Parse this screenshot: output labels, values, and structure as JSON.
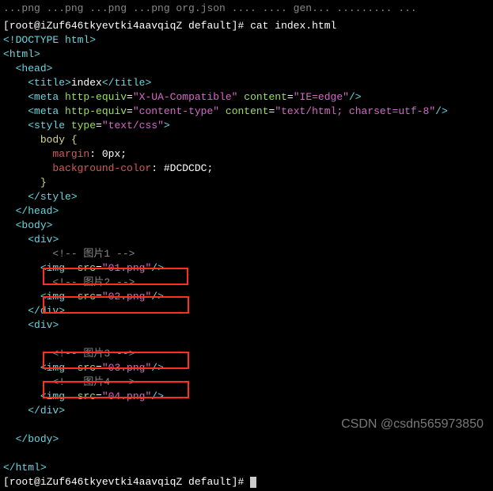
{
  "topTruncated": "...png  ...png  ...png  ...png  org.json  ....  ....  gen...  .........  ...",
  "prompt1": {
    "bracket1": "[",
    "userhost": "root@iZuf646tkyevtki4aavqiqZ",
    "dir": " default",
    "bracket2": "]# ",
    "cmd": "cat index.html"
  },
  "lines": [
    {
      "type": "tag-simple",
      "text": "<!DOCTYPE html>",
      "indent": 0
    },
    {
      "type": "tag-open",
      "tag": "html",
      "indent": 0
    },
    {
      "type": "tag-open",
      "tag": "head",
      "indent": 2
    },
    {
      "type": "title",
      "indent": 4,
      "open": "<title>",
      "content": "index",
      "close": "</title>"
    },
    {
      "type": "meta1",
      "indent": 4
    },
    {
      "type": "meta2",
      "indent": 4
    },
    {
      "type": "style-open",
      "indent": 4
    },
    {
      "type": "css-sel",
      "indent": 6,
      "sel": "body {"
    },
    {
      "type": "css-prop",
      "indent": 8,
      "prop": "margin",
      "val": ": 0px;"
    },
    {
      "type": "css-prop",
      "indent": 8,
      "prop": "background-color",
      "val": ": #DCDCDC;"
    },
    {
      "type": "css-close",
      "indent": 6,
      "text": "}"
    },
    {
      "type": "tag-close",
      "tag": "style",
      "indent": 4
    },
    {
      "type": "tag-close",
      "tag": "head",
      "indent": 2
    },
    {
      "type": "tag-open",
      "tag": "body",
      "indent": 2
    },
    {
      "type": "tag-open",
      "tag": "div",
      "indent": 4
    },
    {
      "type": "comment",
      "indent": 8,
      "text": "<!-- 图片1 -->"
    },
    {
      "type": "img",
      "indent": 6,
      "src": "01.png"
    },
    {
      "type": "comment",
      "indent": 8,
      "text": "<!-- 图片2 -->"
    },
    {
      "type": "img",
      "indent": 6,
      "src": "02.png"
    },
    {
      "type": "tag-close",
      "tag": "div",
      "indent": 4
    },
    {
      "type": "tag-open",
      "tag": "div",
      "indent": 4
    },
    {
      "type": "blank"
    },
    {
      "type": "comment",
      "indent": 8,
      "text": "<!-- 图片3 -->"
    },
    {
      "type": "img",
      "indent": 6,
      "src": "03.png"
    },
    {
      "type": "comment",
      "indent": 8,
      "text": "<!-- 图片4 -->"
    },
    {
      "type": "img",
      "indent": 6,
      "src": "04.png"
    },
    {
      "type": "tag-close",
      "tag": "div",
      "indent": 4
    },
    {
      "type": "blank"
    },
    {
      "type": "tag-close",
      "tag": "body",
      "indent": 2
    },
    {
      "type": "blank"
    },
    {
      "type": "tag-close",
      "tag": "html",
      "indent": 0
    }
  ],
  "meta1": {
    "tag": "meta",
    "attr1": "http-equiv",
    "val1": "X-UA-Compatible",
    "attr2": "content",
    "val2": "IE=edge"
  },
  "meta2": {
    "tag": "meta",
    "attr1": "http-equiv",
    "val1": "content-type",
    "attr2": "content",
    "val2": "text/html; charset=utf-8"
  },
  "styleAttr": {
    "attr": "type",
    "val": "text/css"
  },
  "imgAttr": "src",
  "prompt2": {
    "bracket1": "[",
    "userhost": "root@iZuf646tkyevtki4aavqiqZ",
    "dir": " default",
    "bracket2": "]# "
  },
  "watermark": "CSDN @csdn565973850"
}
